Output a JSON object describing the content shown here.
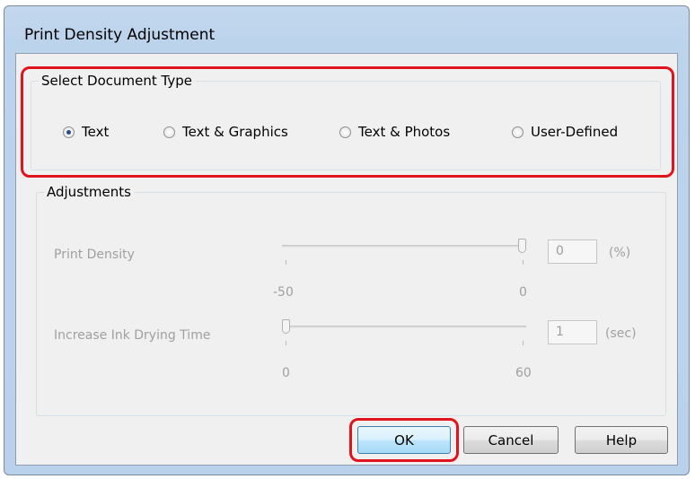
{
  "window": {
    "title": "Print Density Adjustment"
  },
  "doc_type": {
    "label": "Select Document Type",
    "options": [
      {
        "label": "Text",
        "selected": true
      },
      {
        "label": "Text & Graphics",
        "selected": false
      },
      {
        "label": "Text & Photos",
        "selected": false
      },
      {
        "label": "User-Defined",
        "selected": false
      }
    ]
  },
  "adjustments": {
    "label": "Adjustments",
    "print_density": {
      "label": "Print Density",
      "value": "0",
      "unit": "(%)",
      "min_label": "-50",
      "max_label": "0",
      "level": 1.0
    },
    "drying_time": {
      "label": "Increase Ink Drying Time",
      "value": "1",
      "unit": "(sec)",
      "min_label": "0",
      "max_label": "60",
      "level": 0.0
    }
  },
  "buttons": {
    "ok": "OK",
    "cancel": "Cancel",
    "help": "Help"
  },
  "colors": {
    "highlight": "#e0141e",
    "disabled_text": "#a0a0a0",
    "title_bar": "#bcd3ec"
  }
}
